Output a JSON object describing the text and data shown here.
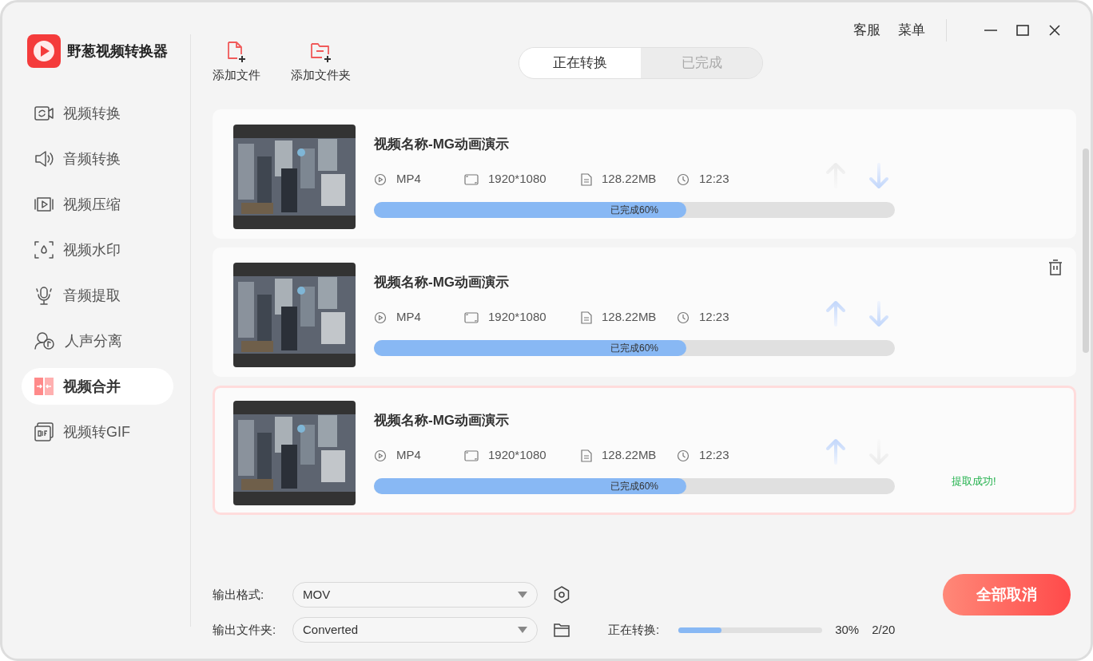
{
  "app": {
    "name": "野葱视频转换器"
  },
  "header": {
    "links": [
      "客服",
      "菜单"
    ]
  },
  "sidebar": {
    "items": [
      {
        "label": "视频转换",
        "selected": false
      },
      {
        "label": "音频转换",
        "selected": false
      },
      {
        "label": "视频压缩",
        "selected": false
      },
      {
        "label": "视频水印",
        "selected": false
      },
      {
        "label": "音频提取",
        "selected": false
      },
      {
        "label": "人声分离",
        "selected": false
      },
      {
        "label": "视频合并",
        "selected": true
      },
      {
        "label": "视频转GIF",
        "selected": false
      }
    ]
  },
  "toolbar": {
    "buttons": [
      "添加文件",
      "添加文件夹"
    ]
  },
  "tabs": [
    {
      "label": "正在转换",
      "selected": true
    },
    {
      "label": "已完成",
      "selected": false
    }
  ],
  "files": [
    {
      "title": "视频名称-MG动画演示",
      "format": "MP4",
      "resolution": "1920*1080",
      "size": "128.22MB",
      "duration": "12:23",
      "level": 0.6,
      "progress_text": "已完成60%",
      "up_enabled": false,
      "down_enabled": true,
      "show_delete": false,
      "selected": false
    },
    {
      "title": "视频名称-MG动画演示",
      "format": "MP4",
      "resolution": "1920*1080",
      "size": "128.22MB",
      "duration": "12:23",
      "level": 0.6,
      "progress_text": "已完成60%",
      "up_enabled": true,
      "down_enabled": true,
      "show_delete": true,
      "selected": false
    },
    {
      "title": "视频名称-MG动画演示",
      "format": "MP4",
      "resolution": "1920*1080",
      "size": "128.22MB",
      "duration": "12:23",
      "level": 0.6,
      "progress_text": "已完成60%",
      "up_enabled": true,
      "down_enabled": false,
      "show_delete": false,
      "selected": true,
      "message": "提取成功!"
    }
  ],
  "output": {
    "format_label": "输出格式:",
    "format_value": "MOV",
    "folder_label": "输出文件夹:",
    "folder_value": "Converted"
  },
  "overall": {
    "label": "正在转换:",
    "level": 0.3,
    "percent": "30%",
    "count": "2/20"
  },
  "cancel_button": "全部取消"
}
